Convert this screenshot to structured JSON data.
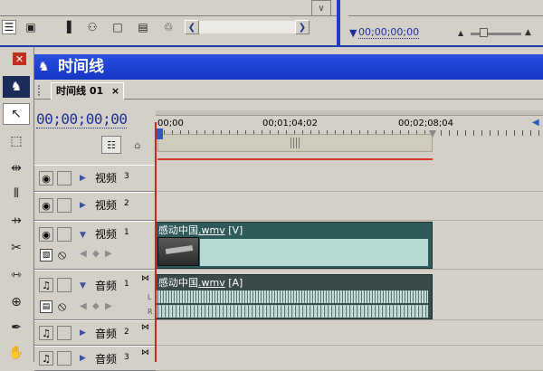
{
  "top": {
    "timecode_secondary": "00;00;00;00"
  },
  "tools": [
    "razor-track-icon",
    "selection-arrow-icon",
    "marquee-icon",
    "ripple-edit-icon",
    "rolling-edit-icon",
    "rate-stretch-icon",
    "razor-icon",
    "slip-icon",
    "slide-icon",
    "pen-icon",
    "hand-icon"
  ],
  "timeline": {
    "title": "时间线",
    "tab_label": "时间线 01",
    "close_glyph": "×",
    "timecode": "00;00;00;00",
    "ruler_labels": [
      "00;00",
      "00;01;04;02",
      "00;02;08;04"
    ]
  },
  "tracks": {
    "video": [
      {
        "name": "视频",
        "num": "3"
      },
      {
        "name": "视频",
        "num": "2"
      },
      {
        "name": "视频",
        "num": "1"
      }
    ],
    "audio": [
      {
        "name": "音频",
        "num": "1"
      },
      {
        "name": "音频",
        "num": "2"
      },
      {
        "name": "音频",
        "num": "3"
      }
    ]
  },
  "clips": {
    "video": {
      "name": "感动中国",
      "ext": ".wmv",
      "tag": "[V]"
    },
    "audio": {
      "name": "感动中国",
      "ext": ".wmv",
      "tag": "[A]"
    },
    "channel_L": "L",
    "channel_R": "R"
  },
  "colors": {
    "title_blue": "#1f3fd0",
    "clip_teal": "#2f5a5a",
    "cursor_red": "#c42a1a"
  }
}
